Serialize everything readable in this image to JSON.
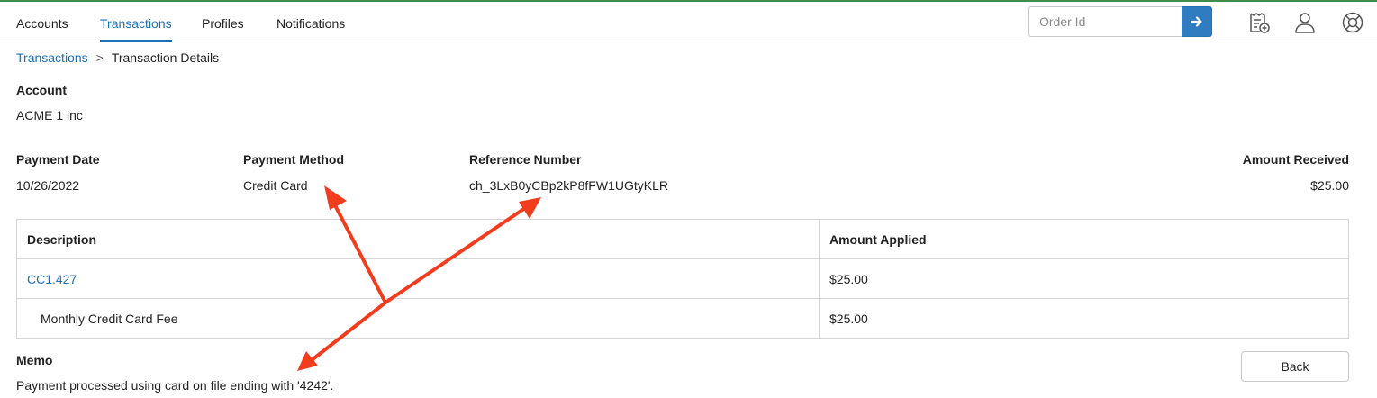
{
  "nav": {
    "tabs": [
      {
        "label": "Accounts"
      },
      {
        "label": "Transactions",
        "active": true
      },
      {
        "label": "Profiles"
      },
      {
        "label": "Notifications"
      }
    ],
    "search_placeholder": "Order Id",
    "search_value": "",
    "icons": [
      "arrow-right-icon",
      "invoice-add-icon",
      "user-icon",
      "help-lifebuoy-icon"
    ]
  },
  "breadcrumb": {
    "parent": "Transactions",
    "separator": ">",
    "current": "Transaction Details"
  },
  "account": {
    "label": "Account",
    "value": "ACME 1 inc"
  },
  "payment": {
    "date_label": "Payment Date",
    "date_value": "10/26/2022",
    "method_label": "Payment Method",
    "method_value": "Credit Card",
    "reference_label": "Reference Number",
    "reference_value": "ch_3LxB0yCBp2kP8fFW1UGtyKLR",
    "amount_label": "Amount Received",
    "amount_value": "$25.00"
  },
  "table": {
    "headers": [
      "Description",
      "Amount Applied"
    ],
    "rows": [
      {
        "description": "CC1.427",
        "amount": "$25.00",
        "is_link": true
      },
      {
        "description": "Monthly Credit Card Fee",
        "amount": "$25.00",
        "is_link": false
      }
    ]
  },
  "memo": {
    "label": "Memo",
    "value": "Payment processed using card on file ending with '4242'."
  },
  "actions": {
    "back_label": "Back"
  },
  "colors": {
    "accent": "#1f6fb2",
    "button_blue": "#2f7cc0",
    "annotation_arrow": "#f23c1e"
  }
}
